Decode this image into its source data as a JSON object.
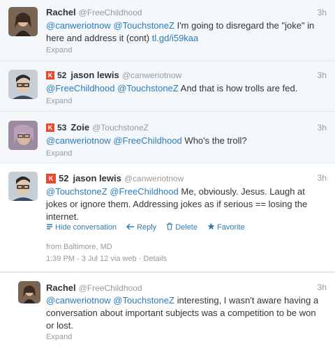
{
  "tweets": [
    {
      "name": "Rachel",
      "handle": "@FreeChildhood",
      "time": "3h",
      "mentions": [
        "@canweriotnow",
        "@TouchstoneZ"
      ],
      "text": "I'm going to disregard the \"joke\" in here and address it (cont)",
      "link": "tl.gd/i59kaa",
      "expand": "Expand"
    },
    {
      "klout": "52",
      "name": "jason lewis",
      "handle": "@canweriotnow",
      "time": "3h",
      "mentions": [
        "@FreeChildhood",
        "@TouchstoneZ"
      ],
      "text": "And that is how trolls are fed.",
      "expand": "Expand"
    },
    {
      "klout": "53",
      "name": "Zoie",
      "handle": "@TouchstoneZ",
      "time": "3h",
      "mentions": [
        "@canweriotnow",
        "@FreeChildhood"
      ],
      "text": "Who's the troll?",
      "expand": "Expand"
    },
    {
      "klout": "52",
      "name": "jason lewis",
      "handle": "@canweriotnow",
      "time": "3h",
      "mentions": [
        "@TouchstoneZ",
        "@FreeChildhood"
      ],
      "text": "Me, obviously. Jesus. Laugh at jokes or ignore them. Addressing jokes as if serious == losing the internet.",
      "actions": {
        "hide": "Hide conversation",
        "reply": "Reply",
        "delete": "Delete",
        "favorite": "Favorite"
      },
      "location": "from Baltimore, MD",
      "timestamp": "1:39 PM - 3 Jul 12 via web",
      "details": "Details"
    },
    {
      "name": "Rachel",
      "handle": "@FreeChildhood",
      "time": "3h",
      "mentions": [
        "@canweriotnow",
        "@TouchstoneZ"
      ],
      "text": "interesting, I wasn't aware having a conversation about important subjects was a competition to be won or lost.",
      "expand": "Expand"
    }
  ],
  "colors": {
    "link": "#2b7bb9",
    "klout": "#e8482d",
    "muted": "#999999"
  },
  "icons": {
    "klout": "klout-icon",
    "hide": "hide-icon",
    "reply": "reply-icon",
    "delete": "trash-icon",
    "favorite": "star-icon"
  }
}
